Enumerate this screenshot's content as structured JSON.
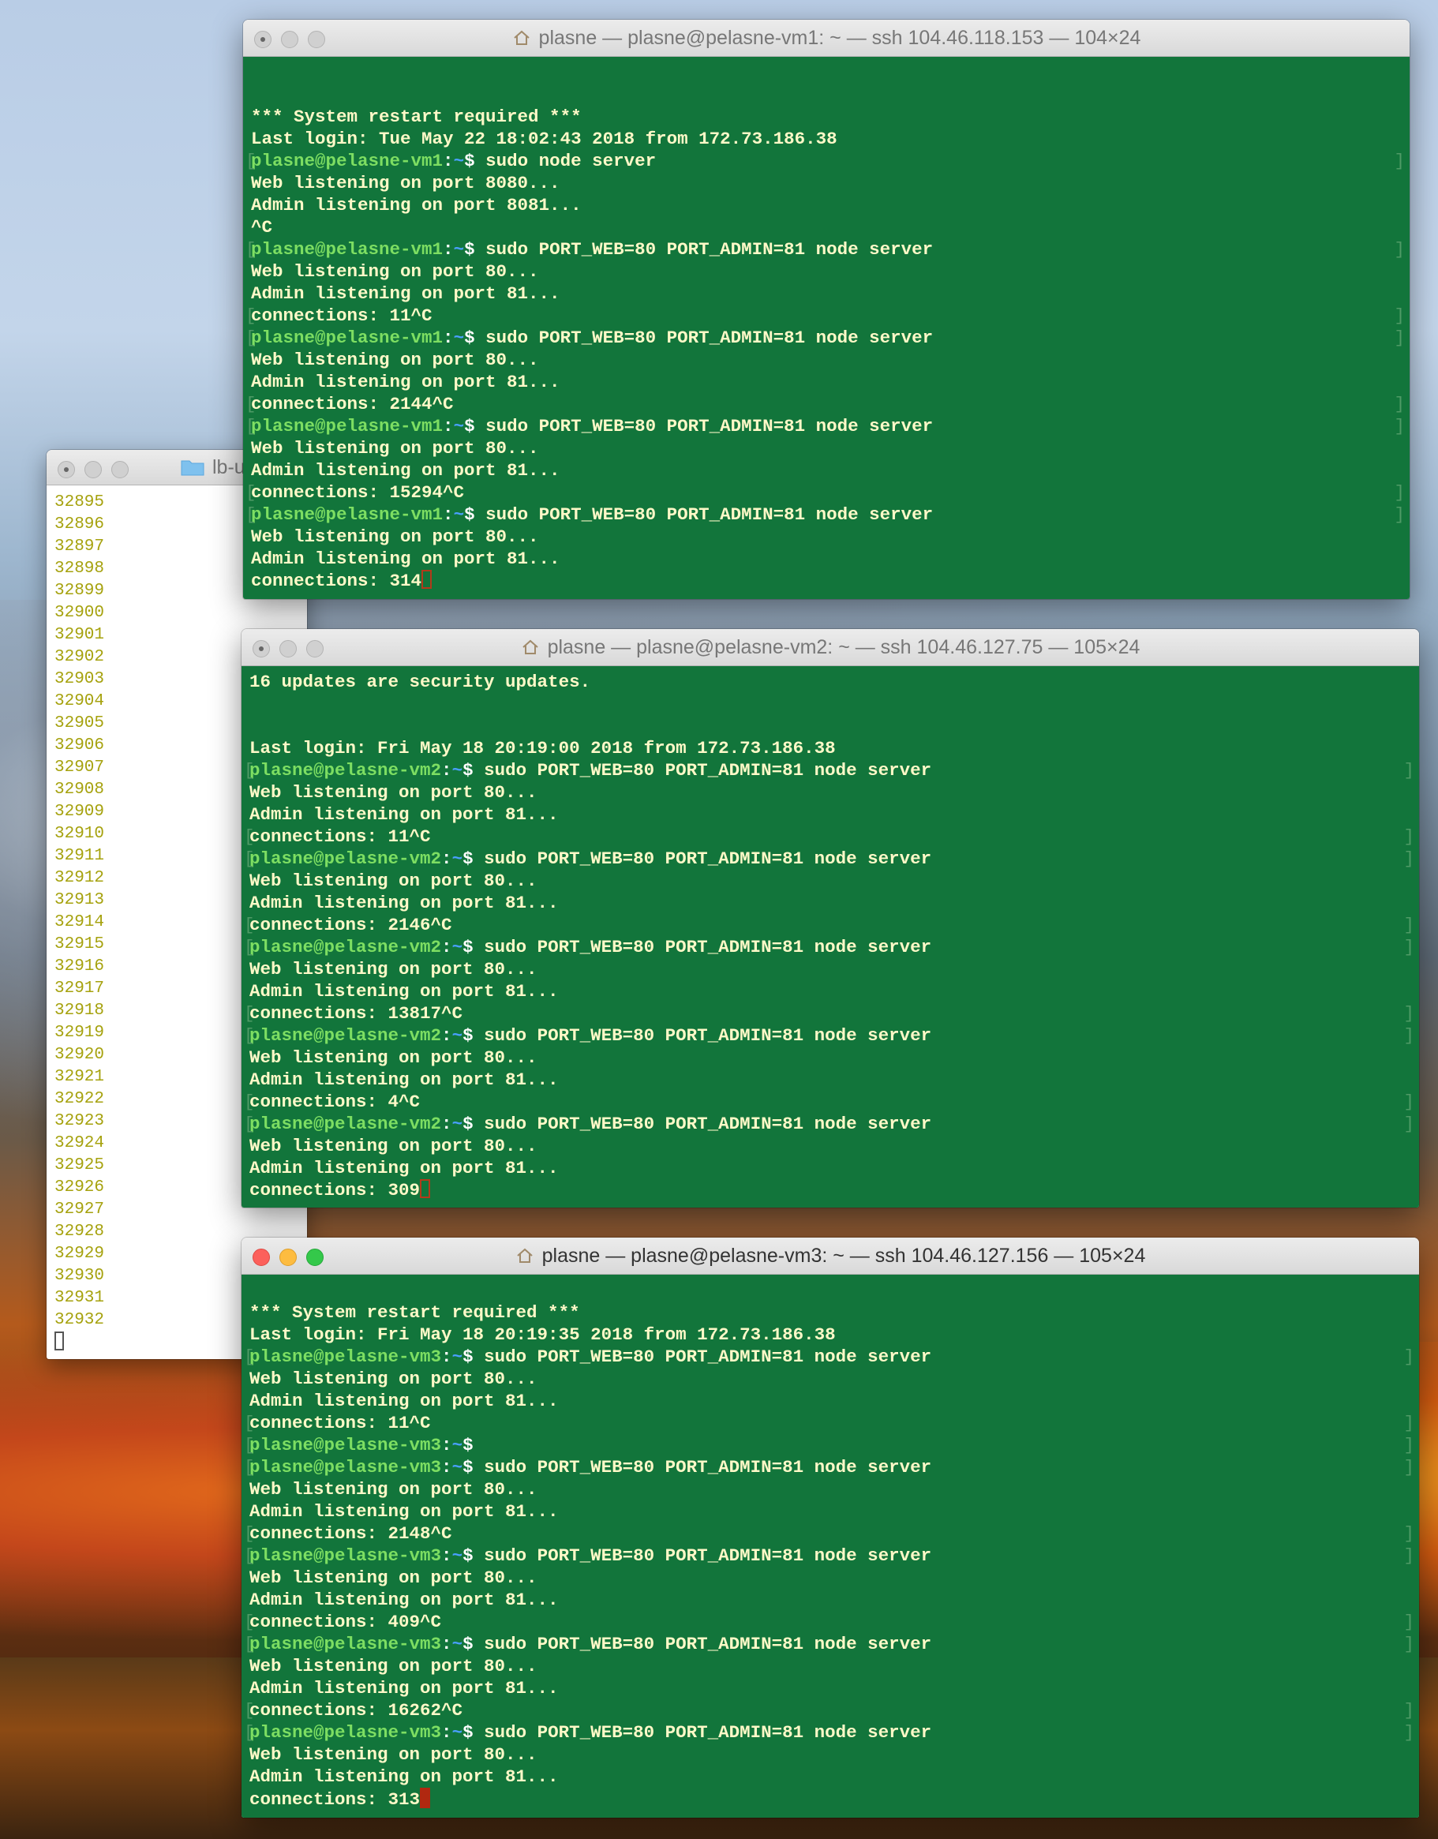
{
  "editor": {
    "title": "lb-u",
    "numbers": [
      "32895",
      "32896",
      "32897",
      "32898",
      "32899",
      "32900",
      "32901",
      "32902",
      "32903",
      "32904",
      "32905",
      "32906",
      "32907",
      "32908",
      "32909",
      "32910",
      "32911",
      "32912",
      "32913",
      "32914",
      "32915",
      "32916",
      "32917",
      "32918",
      "32919",
      "32920",
      "32921",
      "32922",
      "32923",
      "32924",
      "32925",
      "32926",
      "32927",
      "32928",
      "32929",
      "32930",
      "32931",
      "32932"
    ]
  },
  "vm1": {
    "title": "plasne — plasne@pelasne-vm1: ~ — ssh 104.46.118.153 — 104×24",
    "prompt": "plasne@pelasne-vm1",
    "lines": [
      {
        "t": "blank"
      },
      {
        "t": "blank"
      },
      {
        "t": "out",
        "text": "*** System restart required ***"
      },
      {
        "t": "out",
        "text": "Last login: Tue May 22 18:02:43 2018 from 172.73.186.38"
      },
      {
        "t": "cmd",
        "text": "sudo node server"
      },
      {
        "t": "out",
        "text": "Web listening on port 8080..."
      },
      {
        "t": "out",
        "text": "Admin listening on port 8081..."
      },
      {
        "t": "out",
        "text": "^C"
      },
      {
        "t": "cmd",
        "text": "sudo PORT_WEB=80 PORT_ADMIN=81 node server"
      },
      {
        "t": "out",
        "text": "Web listening on port 80..."
      },
      {
        "t": "out",
        "text": "Admin listening on port 81..."
      },
      {
        "t": "bout",
        "text": "connections: 11^C"
      },
      {
        "t": "cmd",
        "text": "sudo PORT_WEB=80 PORT_ADMIN=81 node server"
      },
      {
        "t": "out",
        "text": "Web listening on port 80..."
      },
      {
        "t": "out",
        "text": "Admin listening on port 81..."
      },
      {
        "t": "bout",
        "text": "connections: 2144^C"
      },
      {
        "t": "cmd",
        "text": "sudo PORT_WEB=80 PORT_ADMIN=81 node server"
      },
      {
        "t": "out",
        "text": "Web listening on port 80..."
      },
      {
        "t": "out",
        "text": "Admin listening on port 81..."
      },
      {
        "t": "bout",
        "text": "connections: 15294^C"
      },
      {
        "t": "cmd",
        "text": "sudo PORT_WEB=80 PORT_ADMIN=81 node server"
      },
      {
        "t": "out",
        "text": "Web listening on port 80..."
      },
      {
        "t": "out",
        "text": "Admin listening on port 81..."
      },
      {
        "t": "last",
        "text": "connections: 314"
      }
    ]
  },
  "vm2": {
    "title": "plasne — plasne@pelasne-vm2: ~ — ssh 104.46.127.75 — 105×24",
    "prompt": "plasne@pelasne-vm2",
    "lines": [
      {
        "t": "out",
        "text": "16 updates are security updates."
      },
      {
        "t": "blank"
      },
      {
        "t": "blank"
      },
      {
        "t": "out",
        "text": "Last login: Fri May 18 20:19:00 2018 from 172.73.186.38"
      },
      {
        "t": "cmd",
        "text": "sudo PORT_WEB=80 PORT_ADMIN=81 node server"
      },
      {
        "t": "out",
        "text": "Web listening on port 80..."
      },
      {
        "t": "out",
        "text": "Admin listening on port 81..."
      },
      {
        "t": "bout",
        "text": "connections: 11^C"
      },
      {
        "t": "cmd",
        "text": "sudo PORT_WEB=80 PORT_ADMIN=81 node server"
      },
      {
        "t": "out",
        "text": "Web listening on port 80..."
      },
      {
        "t": "out",
        "text": "Admin listening on port 81..."
      },
      {
        "t": "bout",
        "text": "connections: 2146^C"
      },
      {
        "t": "cmd",
        "text": "sudo PORT_WEB=80 PORT_ADMIN=81 node server"
      },
      {
        "t": "out",
        "text": "Web listening on port 80..."
      },
      {
        "t": "out",
        "text": "Admin listening on port 81..."
      },
      {
        "t": "bout",
        "text": "connections: 13817^C"
      },
      {
        "t": "cmd",
        "text": "sudo PORT_WEB=80 PORT_ADMIN=81 node server"
      },
      {
        "t": "out",
        "text": "Web listening on port 80..."
      },
      {
        "t": "out",
        "text": "Admin listening on port 81..."
      },
      {
        "t": "bout",
        "text": "connections: 4^C"
      },
      {
        "t": "cmd",
        "text": "sudo PORT_WEB=80 PORT_ADMIN=81 node server"
      },
      {
        "t": "out",
        "text": "Web listening on port 80..."
      },
      {
        "t": "out",
        "text": "Admin listening on port 81..."
      },
      {
        "t": "last",
        "text": "connections: 309"
      }
    ]
  },
  "vm3": {
    "title": "plasne — plasne@pelasne-vm3: ~ — ssh 104.46.127.156 — 105×24",
    "prompt": "plasne@pelasne-vm3",
    "lines": [
      {
        "t": "blank"
      },
      {
        "t": "out",
        "text": "*** System restart required ***"
      },
      {
        "t": "out",
        "text": "Last login: Fri May 18 20:19:35 2018 from 172.73.186.38"
      },
      {
        "t": "cmd",
        "text": "sudo PORT_WEB=80 PORT_ADMIN=81 node server"
      },
      {
        "t": "out",
        "text": "Web listening on port 80..."
      },
      {
        "t": "out",
        "text": "Admin listening on port 81..."
      },
      {
        "t": "bout",
        "text": "connections: 11^C"
      },
      {
        "t": "cmd",
        "text": ""
      },
      {
        "t": "cmd",
        "text": "sudo PORT_WEB=80 PORT_ADMIN=81 node server"
      },
      {
        "t": "out",
        "text": "Web listening on port 80..."
      },
      {
        "t": "out",
        "text": "Admin listening on port 81..."
      },
      {
        "t": "bout",
        "text": "connections: 2148^C"
      },
      {
        "t": "cmd",
        "text": "sudo PORT_WEB=80 PORT_ADMIN=81 node server"
      },
      {
        "t": "out",
        "text": "Web listening on port 80..."
      },
      {
        "t": "out",
        "text": "Admin listening on port 81..."
      },
      {
        "t": "bout",
        "text": "connections: 409^C"
      },
      {
        "t": "cmd",
        "text": "sudo PORT_WEB=80 PORT_ADMIN=81 node server"
      },
      {
        "t": "out",
        "text": "Web listening on port 80..."
      },
      {
        "t": "out",
        "text": "Admin listening on port 81..."
      },
      {
        "t": "bout",
        "text": "connections: 16262^C"
      },
      {
        "t": "cmd",
        "text": "sudo PORT_WEB=80 PORT_ADMIN=81 node server"
      },
      {
        "t": "out",
        "text": "Web listening on port 80..."
      },
      {
        "t": "out",
        "text": "Admin listening on port 81..."
      },
      {
        "t": "last",
        "text": "connections: 313"
      }
    ]
  },
  "colors": {
    "terminal_bg": "#12753b",
    "prompt": "#7dde62",
    "text": "#fff9c8",
    "cursor": "#b02810"
  },
  "icons": {
    "home": "home-icon",
    "folder": "folder-icon"
  }
}
